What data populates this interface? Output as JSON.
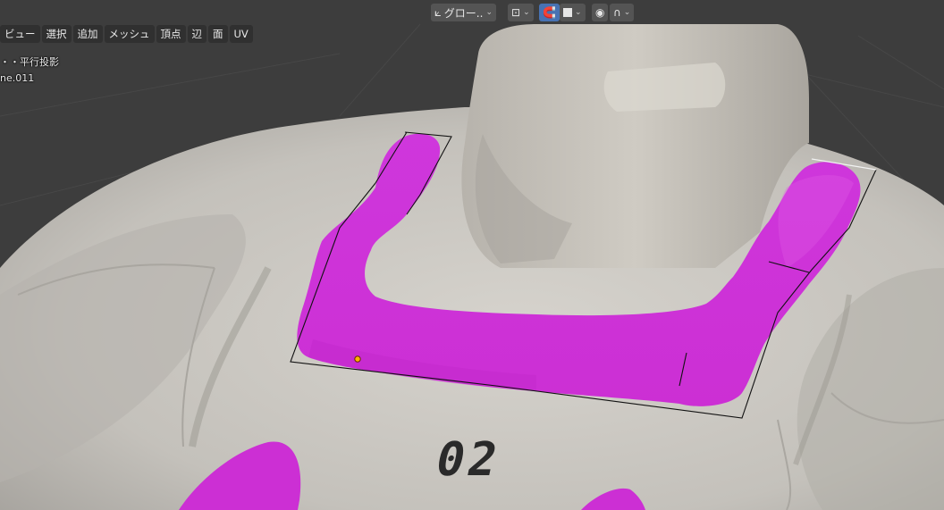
{
  "header": {
    "transform_orientation": "グロー..",
    "snap_icon": "pivot-icon",
    "proportional_icon": "proportional-falloff-icon"
  },
  "menu": {
    "items": [
      "ビュー",
      "選択",
      "追加",
      "メッシュ",
      "頂点",
      "辺",
      "面",
      "UV"
    ]
  },
  "viewport_info": {
    "projection": "・・平行投影",
    "object_name": "ne.011"
  },
  "model": {
    "decal_text": "02",
    "selection_color": "#d12fd8",
    "mesh_color": "#c9c6c0",
    "background_color": "#3d3d3d"
  }
}
